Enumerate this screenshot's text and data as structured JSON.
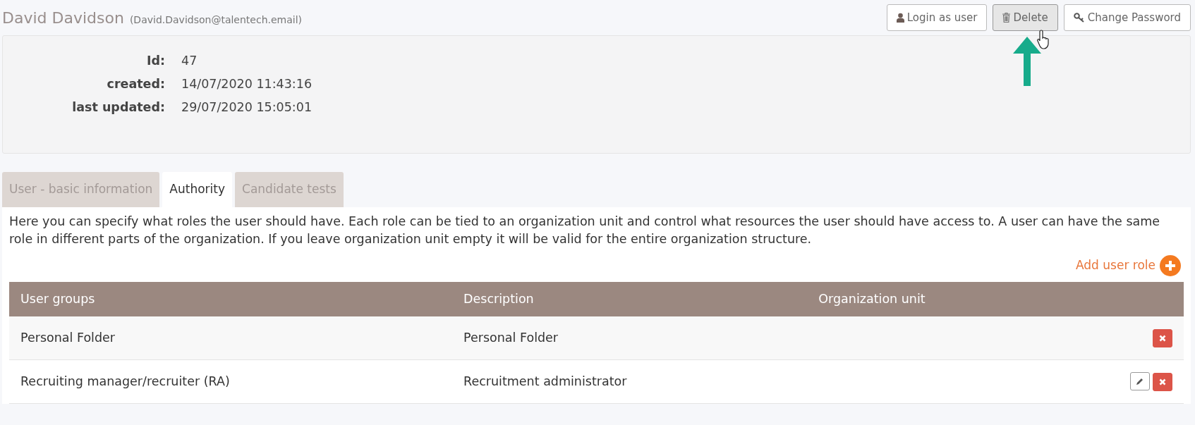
{
  "header": {
    "name": "David Davidson",
    "email": "(David.Davidson@talentech.email)"
  },
  "actions": [
    {
      "kind": "user",
      "label": "Login as user",
      "hovered": false
    },
    {
      "kind": "trash",
      "label": "Delete",
      "hovered": true
    },
    {
      "kind": "key",
      "label": "Change Password",
      "hovered": false
    }
  ],
  "details": [
    {
      "label": "Id:",
      "value": "47"
    },
    {
      "label": "created:",
      "value": "14/07/2020 11:43:16"
    },
    {
      "label": "last updated:",
      "value": "29/07/2020 15:05:01"
    }
  ],
  "tabs": [
    {
      "label": "User - basic information",
      "selected": false
    },
    {
      "label": "Authority",
      "selected": true
    },
    {
      "label": "Candidate tests",
      "selected": false
    }
  ],
  "intro": "Here you can specify what roles the user should have. Each role can be tied to an organization unit and control what resources the user should have access to. A user can have the same role in different parts of the organization. If you leave organization unit empty it will be valid for the entire organization structure.",
  "add_button": "Add user role",
  "table": {
    "columns": [
      "User groups",
      "Description",
      "Organization unit"
    ],
    "rows": [
      {
        "cells": [
          "Personal Folder",
          "Personal Folder"
        ],
        "actions": [
          {
            "kind": "delete"
          }
        ]
      },
      {
        "cells": [
          "Recruiting manager/recruiter (RA)",
          "Recruitment administrator"
        ],
        "actions": [
          {
            "kind": "edit"
          },
          {
            "kind": "delete"
          }
        ]
      }
    ]
  }
}
